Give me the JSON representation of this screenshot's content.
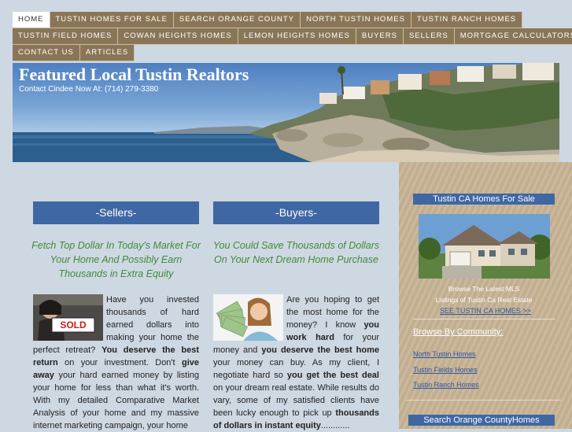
{
  "nav": {
    "row1": [
      "Home",
      "Tustin Homes For Sale",
      "Search Orange County",
      "North Tustin Homes",
      "Tustin Ranch Homes"
    ],
    "row2": [
      "Tustin Field Homes",
      "Cowan Heights Homes",
      "Lemon Heights Homes",
      "Buyers",
      "Sellers",
      "Mortgage Calculators"
    ],
    "row3": [
      "Contact Us",
      "Articles"
    ]
  },
  "banner": {
    "title": "Featured Local Tustin Realtors",
    "subtitle": "Contact Cindee Now At: (714) 279-3380"
  },
  "sellers": {
    "heading": "-Sellers-",
    "tagline": "Fetch Top Dollar In Today's Market For Your Home And Possibly Earn Thousands in Extra Equity",
    "sold_sign": "SOLD",
    "body": [
      {
        "t": "Have you invested thousands of hard earned dollars into making your home the perfect retreat? ",
        "b": false
      },
      {
        "t": "You deserve the best return",
        "b": true
      },
      {
        "t": " on your investment. Don't ",
        "b": false
      },
      {
        "t": "give away",
        "b": true
      },
      {
        "t": " your hard earned money by listing your home for less than what it's worth. With my detailed Comparative Market Analysis of your home and my massive internet marketing campaign, your home",
        "b": false
      }
    ]
  },
  "buyers": {
    "heading": "-Buyers-",
    "tagline": "You Could Save Thousands of Dollars On Your Next Dream Home Purchase",
    "body": [
      {
        "t": "Are you hoping to get the most home for the money? I know ",
        "b": false
      },
      {
        "t": "you work hard",
        "b": true
      },
      {
        "t": " for your money and ",
        "b": false
      },
      {
        "t": "you deserve the best home",
        "b": true
      },
      {
        "t": " your money can buy. As my client, I negotiate hard so ",
        "b": false
      },
      {
        "t": "you get the best deal",
        "b": true
      },
      {
        "t": " on your dream real estate. While results do vary, some of my satisfied clients have been lucky enough to pick up ",
        "b": false
      },
      {
        "t": "thousands of dollars in instant equity",
        "b": true
      },
      {
        "t": "............",
        "b": false
      }
    ]
  },
  "sidebar": {
    "heading1": "Tustin CA Homes For Sale",
    "browse_line1": "Browse The Latest MLS",
    "browse_line2": "Listings of Tustin Ca Real Estate",
    "see_link": "SEE TUSTIN CA HOMES >>",
    "community_heading": "Browse By Community:",
    "communities": [
      "North Tustin Homes",
      "Tustin Fields Homes",
      "Tustin Ranch Homes"
    ],
    "heading2": "Search Orange CountyHomes"
  },
  "colors": {
    "nav": "#8a7657",
    "header_blue": "#3f67a3",
    "tagline_green": "#3f8a3a",
    "sidebar_sand": "#c9b597"
  }
}
